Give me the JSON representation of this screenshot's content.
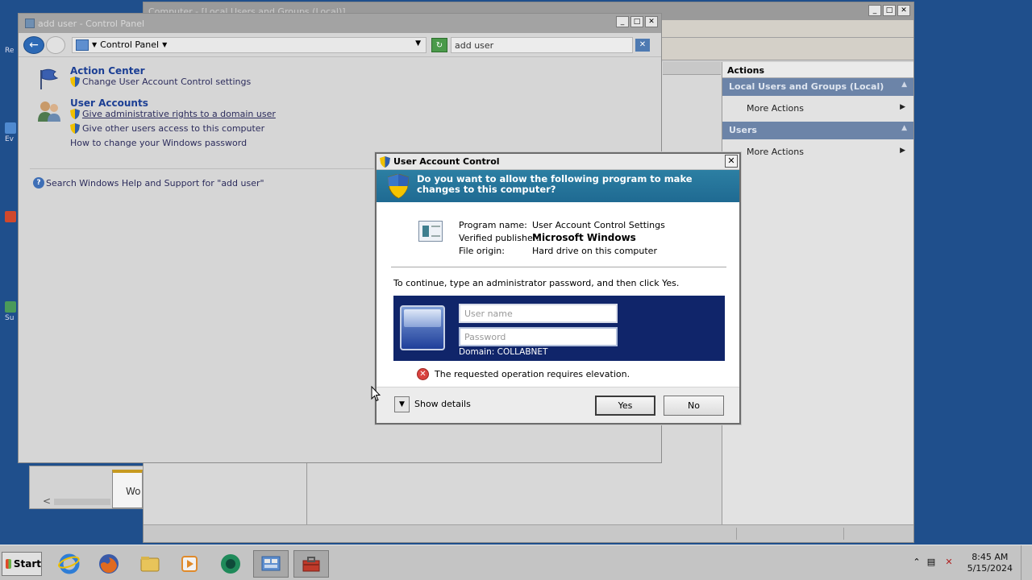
{
  "desktop": {
    "icons": [
      {
        "label": "Re",
        "color": "#3b6ab0"
      },
      {
        "label": "Ev",
        "color": "#4f8ad0"
      },
      {
        "label": "",
        "color": "#d0482c"
      },
      {
        "label": "Su",
        "color": "#4a9a5a"
      }
    ]
  },
  "mmc_window": {
    "title": "Computer - [Local Users and Groups (Local)]",
    "actions_header": "Actions",
    "sections": [
      {
        "label": "Local Users and Groups (Local)",
        "item": "More Actions"
      },
      {
        "label": "Users",
        "item": "More Actions"
      }
    ]
  },
  "tiny_window": {
    "label": "Wo"
  },
  "control_panel": {
    "title": "add user - Control Panel",
    "address": "Control Panel",
    "search_value": "add user",
    "groups": [
      {
        "heading": "Action Center",
        "links": [
          "Change User Account Control settings"
        ]
      },
      {
        "heading": "User Accounts",
        "links": [
          "Give administrative rights to a domain user",
          "Give other users access to this computer",
          "How to change your Windows password"
        ]
      }
    ],
    "help_link": "Search Windows Help and Support for \"add user\""
  },
  "uac": {
    "title": "User Account Control",
    "question": "Do you want to allow the following program to make changes to this computer?",
    "program_name_label": "Program name:",
    "program_name": "User Account Control Settings",
    "publisher_label": "Verified publisher:",
    "publisher": "Microsoft Windows",
    "origin_label": "File origin:",
    "origin": "Hard drive on this computer",
    "instruction": "To continue, type an administrator password, and then click Yes.",
    "username_placeholder": "User name",
    "password_placeholder": "Password",
    "domain": "Domain: COLLABNET",
    "error": "The requested operation requires elevation.",
    "show_details": "Show details",
    "yes": "Yes",
    "no": "No"
  },
  "taskbar": {
    "start": "Start",
    "apps": [
      {
        "name": "internet-explorer-icon",
        "color": "#2e7dd6"
      },
      {
        "name": "firefox-icon",
        "color": "#e06a1f"
      },
      {
        "name": "explorer-folder-icon",
        "color": "#e8c45a"
      },
      {
        "name": "media-player-icon",
        "color": "#e08a2a"
      },
      {
        "name": "green-app-icon",
        "color": "#1f8a5a"
      },
      {
        "name": "control-panel-icon",
        "color": "#5f8fcf"
      },
      {
        "name": "toolbox-icon",
        "color": "#c03a2a"
      }
    ],
    "time": "8:45 AM",
    "date": "5/15/2024"
  }
}
